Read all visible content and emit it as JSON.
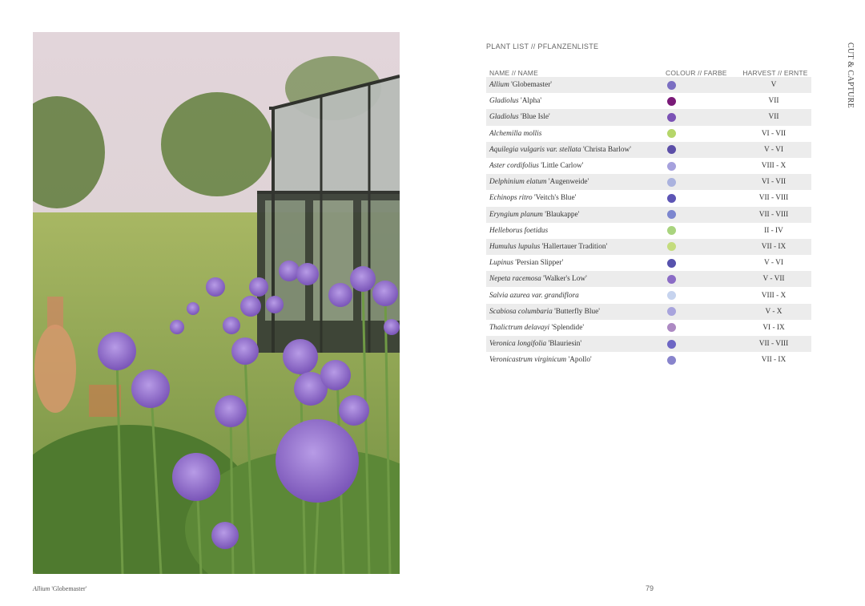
{
  "photo": {
    "description_icon": "allium-garden-photo"
  },
  "caption": {
    "botanical": "Allium",
    "cultivar": "'Globemaster'"
  },
  "page_number": "79",
  "section_title": "CUT & CAPTURE",
  "plant_list": {
    "title": "PLANT LIST // PFLANZENLISTE",
    "columns": {
      "name": "NAME // NAME",
      "colour": "COLOUR // FARBE",
      "harvest": "HARVEST // ERNTE"
    },
    "rows": [
      {
        "botanical": "Allium",
        "cultivar": "'Globemaster'",
        "color": "#7b6fc2",
        "harvest": "V"
      },
      {
        "botanical": "Gladiolus",
        "cultivar": "'Alpha'",
        "color": "#7a1a78",
        "harvest": "VII"
      },
      {
        "botanical": "Gladiolus",
        "cultivar": "'Blue Isle'",
        "color": "#7b52b5",
        "harvest": "VII"
      },
      {
        "botanical": "Alchemilla mollis",
        "cultivar": "",
        "color": "#b5d66a",
        "harvest": "VI - VII"
      },
      {
        "botanical": "Aquilegia vulgaris var. stellata",
        "cultivar": "'Christa Barlow'",
        "color": "#5c4fa8",
        "harvest": "V - VI"
      },
      {
        "botanical": "Aster cordifolius",
        "cultivar": "'Little Carlow'",
        "color": "#a6a1dd",
        "harvest": "VIII - X"
      },
      {
        "botanical": "Delphinium elatum",
        "cultivar": "'Augenweide'",
        "color": "#aab2de",
        "harvest": "VI - VII"
      },
      {
        "botanical": "Echinops ritro",
        "cultivar": "'Veitch's Blue'",
        "color": "#5d55b5",
        "harvest": "VII - VIII"
      },
      {
        "botanical": "Eryngium planum",
        "cultivar": "'Blaukappe'",
        "color": "#7c86cf",
        "harvest": "VII - VIII"
      },
      {
        "botanical": "Helleborus foetidus",
        "cultivar": "",
        "color": "#a9d47e",
        "harvest": "II - IV"
      },
      {
        "botanical": "Humulus lupulus",
        "cultivar": "'Hallertauer Tradition'",
        "color": "#c4dc7d",
        "harvest": "VII - IX"
      },
      {
        "botanical": "Lupinus",
        "cultivar": "'Persian Slipper'",
        "color": "#5752ad",
        "harvest": "V - VI"
      },
      {
        "botanical": "Nepeta racemosa",
        "cultivar": "'Walker's Low'",
        "color": "#8b6cc6",
        "harvest": "V - VII"
      },
      {
        "botanical": "Salvia azurea var. grandiflora",
        "cultivar": "",
        "color": "#c6d3ee",
        "harvest": "VIII - X"
      },
      {
        "botanical": "Scabiosa columbaria",
        "cultivar": "'Butterfly Blue'",
        "color": "#a8a4dd",
        "harvest": "V - X"
      },
      {
        "botanical": "Thalictrum delavayi",
        "cultivar": "'Splendide'",
        "color": "#ad8ac3",
        "harvest": "VI - IX"
      },
      {
        "botanical": "Veronica longifolia",
        "cultivar": "'Blauriesin'",
        "color": "#6d66c4",
        "harvest": "VII - VIII"
      },
      {
        "botanical": "Veronicastrum virginicum",
        "cultivar": "'Apollo'",
        "color": "#8884cc",
        "harvest": "VII - IX"
      }
    ]
  }
}
